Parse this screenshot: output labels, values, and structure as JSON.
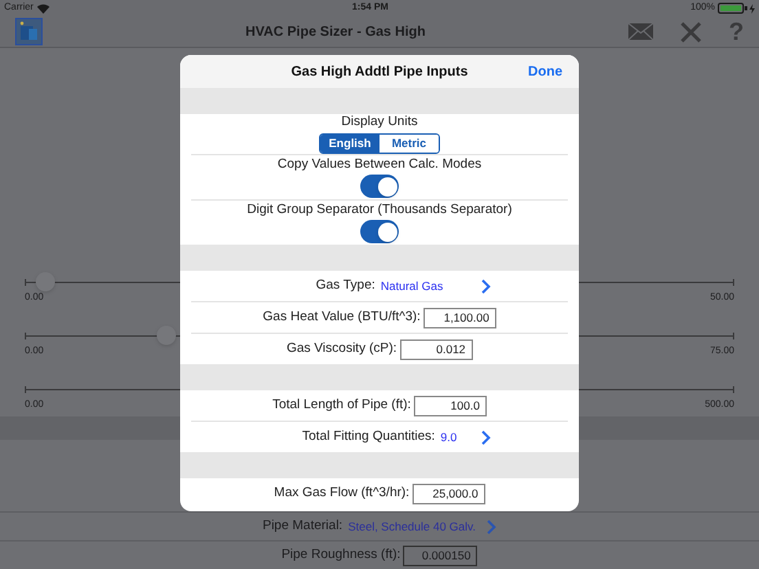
{
  "status_bar": {
    "carrier": "Carrier",
    "time": "1:54 PM",
    "battery": "100%"
  },
  "nav": {
    "title": "HVAC Pipe Sizer - Gas High",
    "help": "?"
  },
  "sliders": [
    {
      "min": "0.00",
      "max": "50.00",
      "level": 0.03
    },
    {
      "min": "0.00",
      "max": "75.00",
      "level": 0.2
    },
    {
      "min": "0.00",
      "max": "500.00"
    }
  ],
  "background_rows": [
    {
      "kind": "link",
      "label": "Pipe Material:",
      "value": "Steel, Schedule 40 Galv."
    },
    {
      "kind": "field",
      "label": "Pipe Roughness (ft):",
      "value": "0.000150"
    }
  ],
  "modal": {
    "title": "Gas High Addtl Pipe Inputs",
    "done": "Done",
    "sections": [
      [
        {
          "kind": "units",
          "label": "Display Units",
          "options": [
            {
              "label": "English",
              "selected": true
            },
            {
              "label": "Metric",
              "selected": false
            }
          ]
        },
        {
          "kind": "toggle",
          "label": "Copy Values Between Calc. Modes",
          "on": true
        },
        {
          "kind": "toggle",
          "label": "Digit Group Separator (Thousands Separator)",
          "on": true
        }
      ],
      [
        {
          "kind": "link",
          "label": "Gas Type:",
          "value": "Natural Gas"
        },
        {
          "kind": "field",
          "label": "Gas Heat Value (BTU/ft^3):",
          "value": "1,100.00"
        },
        {
          "kind": "field",
          "label": "Gas Viscosity (cP):",
          "value": "0.012"
        }
      ],
      [
        {
          "kind": "field",
          "label": "Total Length of Pipe (ft):",
          "value": "100.0"
        },
        {
          "kind": "link",
          "label": "Total Fitting Quantities:",
          "value": "9.0"
        }
      ],
      [
        {
          "kind": "field",
          "label": "Max Gas Flow (ft^3/hr):",
          "value": "25,000.0"
        }
      ]
    ]
  }
}
